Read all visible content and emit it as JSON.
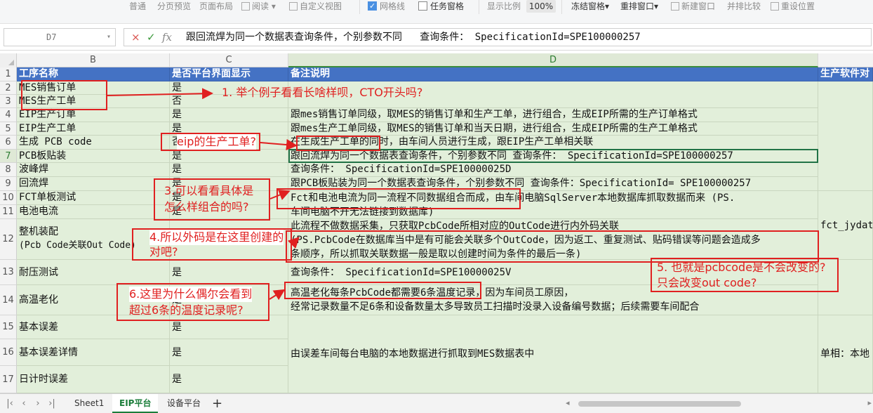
{
  "toolbar": {
    "items": [
      "普通",
      "分页预览",
      "页面布局",
      "阅读",
      "自定义视图",
      "网格线",
      "任务窗格",
      "显示比例",
      "100%",
      "冻结窗格",
      "重排窗口",
      "新建窗口",
      "并排比较",
      "重设位置"
    ]
  },
  "formula_bar": {
    "cell_ref": "D7",
    "cancel": "×",
    "confirm": "✓",
    "fx": "fx",
    "content": "跟回流焊为同一个数据表查询条件，个别参数不同   查询条件： SpecificationId=SPE100000257"
  },
  "columns": [
    "B",
    "C",
    "D"
  ],
  "rows": [
    "1",
    "2",
    "3",
    "4",
    "5",
    "6",
    "7",
    "8",
    "9",
    "10",
    "11",
    "12",
    "13",
    "14",
    "15",
    "16",
    "17"
  ],
  "cells": {
    "B1": "工序名称",
    "C1": "是否平台界面显示",
    "D1": "备注说明",
    "E1": "生产软件对",
    "B2": "MES销售订单",
    "C2": "是",
    "B3": "MES生产工单",
    "C3": "否",
    "B4": "EIP生产订单",
    "C4": "是",
    "D4": "跟mes销售订单同级，取MES的销售订单和生产工单，进行组合，生成EIP所需的生产订单格式",
    "B5": "EIP生产工单",
    "C5": "是",
    "D5": "跟mes生产工单同级，取MES的销售订单和当天日期，进行组合，生成EIP所需的生产工单格式",
    "B6": "生成 PCB code",
    "C6": "否",
    "D6": "在生成生产工单的同时，由车间人员进行生成，跟EIP生产工单相关联",
    "B7": "PCB板贴装",
    "C7": "是",
    "D7": "跟回流焊为同一个数据表查询条件，个别参数不同   查询条件： SpecificationId=SPE100000257",
    "B8": "波峰焊",
    "C8": "是",
    "D8": "查询条件： SpecificationId=SPE10000025D",
    "B9": "回流焊",
    "C9": "是",
    "D9": "跟PCB板贴装为同一个数据表查询条件，个别参数不同   查询条件：SpecificationId= SPE100000257",
    "B10": "FCT单板测试",
    "C10": "是",
    "D10a": "Fct和电池电流为同一流程不同数据组合而成，由车间电脑SqlServer本地数据库抓取数据而来        (PS.",
    "D10b": "车间电脑不开无法链接到数据库)",
    "E10": "fct_jydata",
    "B11": "电池电流",
    "C11": "是",
    "B12a": "整机装配",
    "B12b": "(Pcb Code关联Out Code)",
    "C12": "否",
    "D12a": "此流程不做数据采集，只获取PcbCode所相对应的OutCode进行内外码关联",
    "D12b": "(PS.PcbCode在数据库当中是有可能会关联多个OutCode，因为返工、重复测试、贴码错误等问题会造成多",
    "D12c": "条顺序，所以抓取关联数据一般是取以创建时间为条件的最后一条)",
    "B13": "耐压测试",
    "C13": "是",
    "D13": "查询条件： SpecificationId=SPE10000025V",
    "B14": "高温老化",
    "C14": "是",
    "D14a": "高温老化每条PcbCode都需要6条温度记录，因为车间员工原因，",
    "D14b": "经常记录数量不足6条和设备数量太多导致员工扫描时没录入设备编号数据；后续需要车间配合",
    "B15": "基本误差",
    "C15": "是",
    "B16": "基本误差详情",
    "C16": "是",
    "D16": "由误差车间每台电脑的本地数据进行抓取到MES数据表中",
    "E16": "单相：本地",
    "B17": "日计时误差",
    "C17": "是"
  },
  "annotations": {
    "n1": "1. 举个例子看看长啥样呗，CTO开头吗?",
    "n2": "eip的生产工单?",
    "n3a": "3.可以看看具体是",
    "n3b": "怎么样组合的吗?",
    "n4a": "4.所以外码是在这里创建的",
    "n4b": "对吧?",
    "n5a": "5. 也就是pcbcode是不会改变的?",
    "n5b": "只会改变out code?",
    "n6a": "6.这里为什么偶尔会看到",
    "n6b": "超过6条的温度记录呢?"
  },
  "sheets": {
    "tabs": [
      "Sheet1",
      "EIP平台",
      "设备平台"
    ],
    "active": "EIP平台",
    "add": "+"
  },
  "colors": {
    "header_blue": "#4472c4",
    "cell_green": "#e2efda",
    "annotation_red": "#e02020",
    "active_green": "#217346"
  }
}
